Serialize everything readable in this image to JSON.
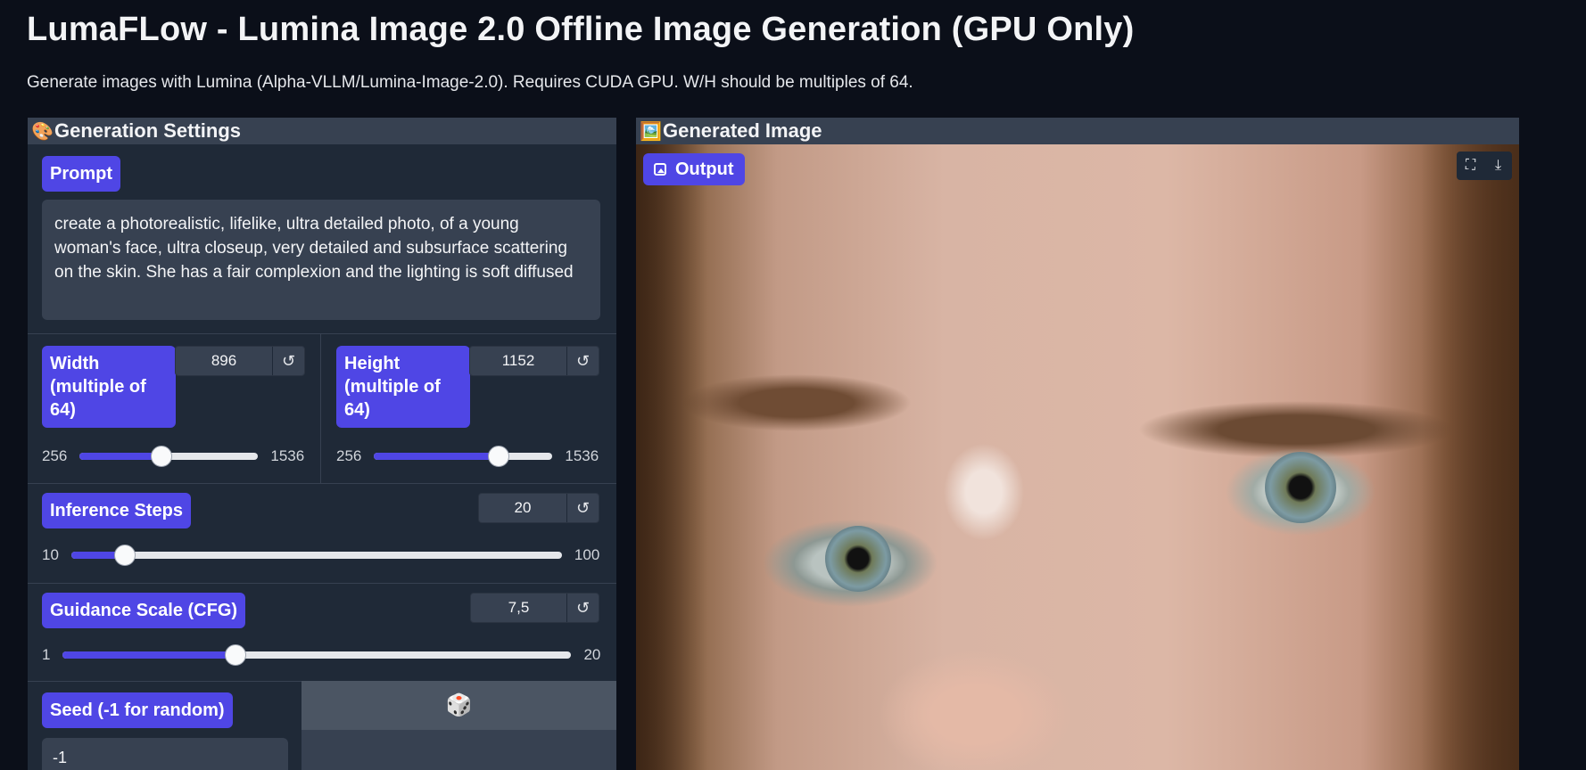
{
  "header": {
    "title": "LumaFLow - Lumina Image 2.0 Offline Image Generation (GPU Only)",
    "description": "Generate images with Lumina (Alpha-VLLM/Lumina-Image-2.0). Requires CUDA GPU. W/H should be multiples of 64."
  },
  "settings": {
    "title": "Generation Settings",
    "icon": "palette-icon",
    "prompt_label": "Prompt",
    "prompt_value": "create a photorealistic, lifelike, ultra detailed photo, of a young woman's face, ultra closeup, very detailed and subsurface scattering on the skin. She has a fair complexion and the lighting is soft diffused",
    "width": {
      "label": "Width (multiple of 64)",
      "value": "896",
      "min": "256",
      "max": "1536",
      "fraction": 0.46
    },
    "height": {
      "label": "Height (multiple of 64)",
      "value": "1152",
      "min": "256",
      "max": "1536",
      "fraction": 0.7
    },
    "steps": {
      "label": "Inference Steps",
      "value": "20",
      "min": "10",
      "max": "100",
      "fraction": 0.11
    },
    "cfg": {
      "label": "Guidance Scale (CFG)",
      "value": "7,5",
      "min": "1",
      "max": "20",
      "fraction": 0.34
    },
    "seed": {
      "label": "Seed (-1 for random)",
      "value": "-1",
      "randomize_icon": "dice-icon"
    },
    "reset_icon": "↺"
  },
  "output": {
    "title": "Generated Image",
    "icon": "picture-icon",
    "badge_label": "Output",
    "tools": [
      "fullscreen-icon",
      "download-icon"
    ]
  }
}
